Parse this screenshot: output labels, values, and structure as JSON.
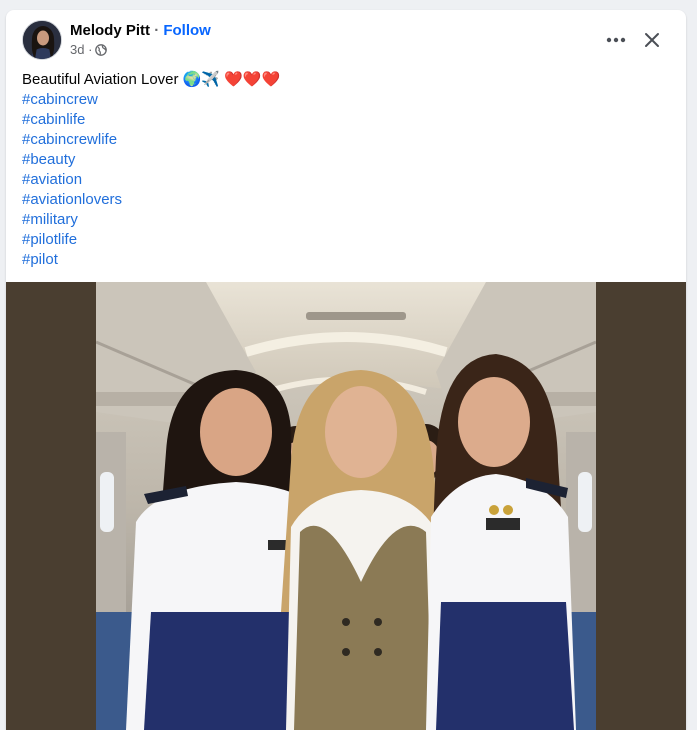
{
  "post": {
    "author": "Melody Pitt",
    "separator": "·",
    "follow_label": "Follow",
    "time": "3d ·",
    "caption_text": "Beautiful  Aviation Lover 🌍✈️ ❤️❤️❤️",
    "hashtags": [
      "#cabincrew",
      "#cabinlife",
      "#cabincrewlife",
      "#beauty",
      "#aviation",
      "#aviationlovers",
      "#military",
      "#pilotlife",
      "#pilot"
    ],
    "more_icon": "more-options-icon",
    "close_icon": "close-icon",
    "privacy_icon": "globe-icon"
  },
  "colors": {
    "follow": "#0866ff",
    "hashtag": "#216fdb",
    "media_background": "#4a3e30"
  }
}
